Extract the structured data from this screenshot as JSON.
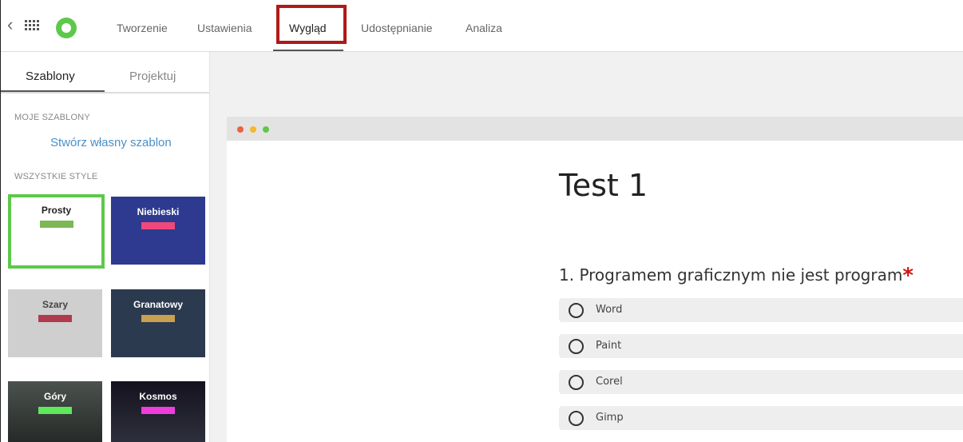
{
  "topbar": {
    "tabs": [
      {
        "label": "Tworzenie"
      },
      {
        "label": "Ustawienia"
      },
      {
        "label": "Wygląd",
        "active": true,
        "highlighted": true
      },
      {
        "label": "Udostępnianie"
      },
      {
        "label": "Analiza"
      }
    ],
    "icons": [
      "chevron-left-icon",
      "apps-grid-icon",
      "logo-icon"
    ],
    "colors": {
      "logo": "#5ec84b",
      "highlight": "#b11919"
    }
  },
  "sidebar": {
    "tabs": [
      {
        "label": "Szablony",
        "active": true
      },
      {
        "label": "Projektuj"
      }
    ],
    "my_templates_label": "MOJE SZABLONY",
    "create_template_link": "Stwórz własny szablon",
    "all_styles_label": "WSZYSTKIE STYLE",
    "styles": [
      {
        "name": "Prosty",
        "bg": "#ffffff",
        "text": "#222222",
        "accent": "#7cb855",
        "selected": true
      },
      {
        "name": "Niebieski",
        "bg": "#2d3a8f",
        "text": "#ffffff",
        "accent": "#f0487a"
      },
      {
        "name": "Szary",
        "bg": "#cfcfcf",
        "text": "#444444",
        "accent": "#b03a4e"
      },
      {
        "name": "Granatowy",
        "bg": "#2c3a4f",
        "text": "#ffffff",
        "accent": "#c9a050"
      },
      {
        "name": "Góry",
        "bg": "#3a3f3c",
        "text": "#ffffff",
        "accent": "#5ee85a"
      },
      {
        "name": "Kosmos",
        "bg": "#1e1a2a",
        "text": "#ffffff",
        "accent": "#f03cdc"
      }
    ]
  },
  "preview": {
    "window_dots": [
      "#f06040",
      "#f5b82e",
      "#5ec84b"
    ],
    "title": "Test 1",
    "question": "1. Programem graficznym nie jest program",
    "required_mark": "*",
    "options": [
      "Word",
      "Paint",
      "Corel",
      "Gimp"
    ]
  }
}
